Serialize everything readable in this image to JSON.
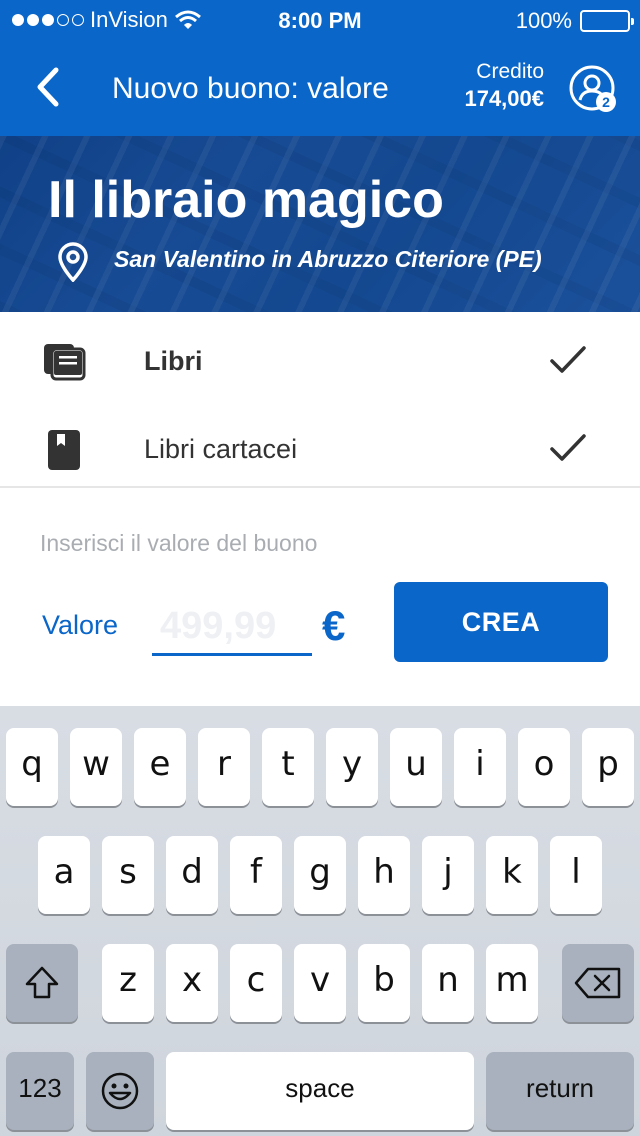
{
  "status_bar": {
    "carrier": "InVision",
    "time": "8:00 PM",
    "battery": "100%"
  },
  "nav": {
    "title": "Nuovo buono: valore",
    "credit_label": "Credito",
    "credit_value": "174,00€",
    "notification_count": "2"
  },
  "store": {
    "name": "Il libraio magico",
    "location": "San Valentino in Abruzzo Citeriore (PE)"
  },
  "categories": [
    {
      "label": "Libri",
      "icon": "books-icon",
      "checked": true
    },
    {
      "label": "Libri cartacei",
      "icon": "bookmark-book-icon",
      "checked": true
    }
  ],
  "voucher": {
    "hint": "Inserisci il valore del buono",
    "value_label": "Valore",
    "value_placeholder": "499,99",
    "currency": "€",
    "submit_label": "CREA"
  },
  "keyboard": {
    "row1": [
      "q",
      "w",
      "e",
      "r",
      "t",
      "y",
      "u",
      "i",
      "o",
      "p"
    ],
    "row2": [
      "a",
      "s",
      "d",
      "f",
      "g",
      "h",
      "j",
      "k",
      "l"
    ],
    "row3": [
      "z",
      "x",
      "c",
      "v",
      "b",
      "n",
      "m"
    ],
    "numbers_label": "123",
    "space_label": "space",
    "return_label": "return"
  },
  "colors": {
    "primary": "#0a66c8",
    "text": "#333333",
    "hint": "#a9adb2"
  }
}
